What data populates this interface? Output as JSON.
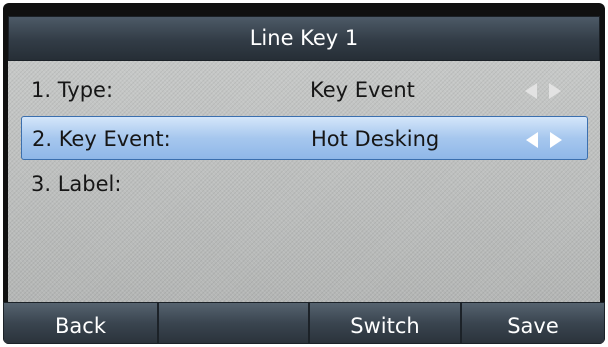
{
  "title": "Line Key 1",
  "rows": [
    {
      "label": "1. Type:",
      "value": "Key Event",
      "has_arrows": true,
      "selected": false
    },
    {
      "label": "2. Key Event:",
      "value": "Hot Desking",
      "has_arrows": true,
      "selected": true
    },
    {
      "label": "3. Label:",
      "value": "",
      "has_arrows": false,
      "selected": false
    }
  ],
  "softkeys": [
    "Back",
    "",
    "Switch",
    "Save"
  ],
  "colors": {
    "selection": "#a6c7ee",
    "title_bar": "#323c46",
    "softkey": "#3a4550",
    "content_background": "#b8bab9"
  }
}
